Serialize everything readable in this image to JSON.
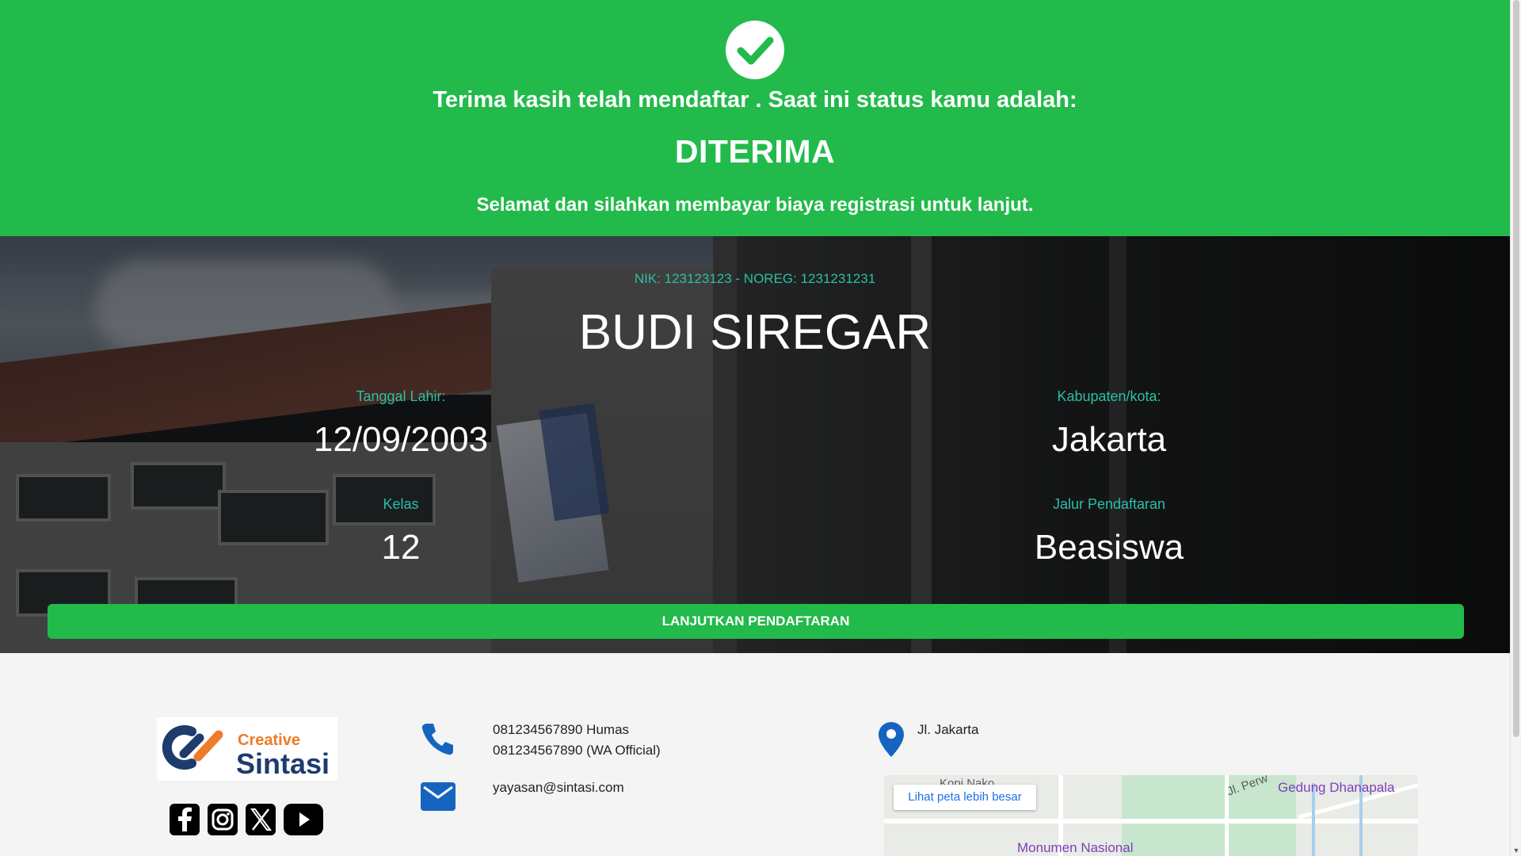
{
  "banner": {
    "thanks_text": "Terima kasih telah mendaftar . Saat ini status kamu adalah:",
    "status": "DITERIMA",
    "message": "Selamat dan silahkan membayar biaya registrasi untuk lanjut.",
    "icon": "check-circle-icon",
    "color": "#22ba4b"
  },
  "applicant": {
    "ids": "NIK: 123123123 - NOREG: 1231231231",
    "name": "BUDI SIREGAR",
    "fields": [
      {
        "label": "Tanggal Lahir:",
        "value": "12/09/2003"
      },
      {
        "label": "Kabupaten/kota:",
        "value": "Jakarta"
      },
      {
        "label": "Kelas",
        "value": "12"
      },
      {
        "label": "Jalur Pendaftaran",
        "value": "Beasiswa"
      }
    ],
    "continue_button": "LANJUTKAN PENDAFTARAN"
  },
  "footer": {
    "logo": {
      "line1": "Creative",
      "line2": "Sintasi"
    },
    "social": [
      "facebook-icon",
      "instagram-icon",
      "x-icon",
      "youtube-icon"
    ],
    "phone_lines": [
      "081234567890 Humas",
      "081234567890 (WA Official)"
    ],
    "email": "yayasan@sintasi.com",
    "address": "Jl. Jakarta",
    "map": {
      "larger_map_link": "Lihat peta lebih besar",
      "labels": [
        "Kopi Nako",
        "Jl. Perw",
        "Gedung Dhanapala",
        "Monumen Nasional"
      ]
    }
  }
}
